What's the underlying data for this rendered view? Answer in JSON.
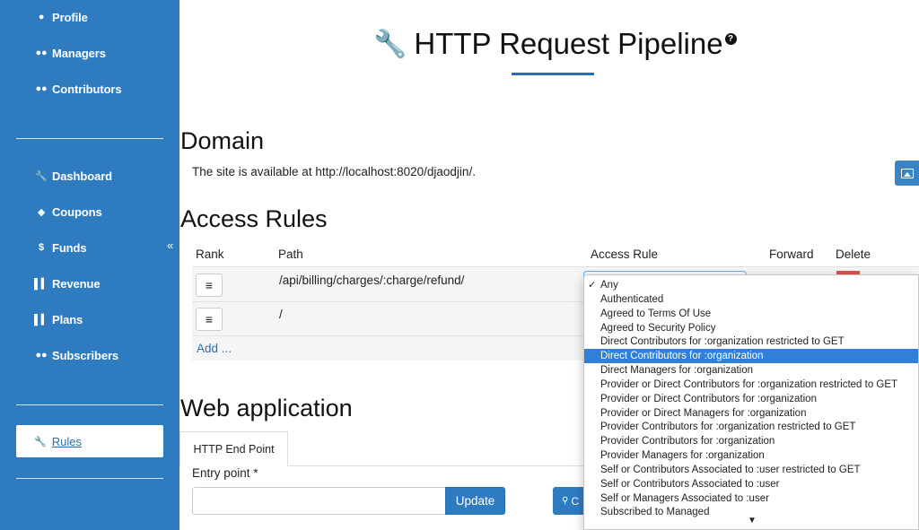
{
  "sidebar": {
    "items_top": [
      {
        "label": "Profile",
        "icon": "user-icon"
      },
      {
        "label": "Managers",
        "icon": "users-icon"
      },
      {
        "label": "Contributors",
        "icon": "users-icon"
      }
    ],
    "items_main": [
      {
        "label": "Dashboard",
        "icon": "wrench-icon"
      },
      {
        "label": "Coupons",
        "icon": "tag-icon"
      },
      {
        "label": "Funds",
        "icon": "dollar-icon"
      },
      {
        "label": "Revenue",
        "icon": "bar-chart-icon"
      },
      {
        "label": "Plans",
        "icon": "bar-chart-icon"
      },
      {
        "label": "Subscribers",
        "icon": "users-icon"
      }
    ],
    "collapse_glyph": "«",
    "active_item": {
      "label": "Rules",
      "icon": "wrench-icon"
    },
    "accent": "#2f7bbf"
  },
  "header": {
    "title": "HTTP Request Pipeline",
    "help_glyph": "?"
  },
  "domain": {
    "heading": "Domain",
    "text": "The site is available at http://localhost:8020/djaodjin/."
  },
  "access_rules": {
    "heading": "Access Rules",
    "columns": [
      "Rank",
      "Path",
      "Access Rule",
      "Forward",
      "Delete"
    ],
    "rows": [
      {
        "rank_glyph": "≡",
        "path": "/api/billing/charges/:charge/refund/"
      },
      {
        "rank_glyph": "≡",
        "path": "/"
      }
    ],
    "add_label": "Add ..."
  },
  "web_app": {
    "heading": "Web application",
    "tab_label": "HTTP End Point",
    "entry_label": "Entry point *",
    "entry_value": "",
    "update_label": "Update",
    "partial_button_label": "C"
  },
  "dropdown": {
    "options": [
      {
        "label": "Any",
        "checked": true
      },
      {
        "label": "Authenticated"
      },
      {
        "label": "Agreed to Terms Of Use"
      },
      {
        "label": "Agreed to Security Policy"
      },
      {
        "label": "Direct Contributors for :organization restricted to GET"
      },
      {
        "label": "Direct Contributors for :organization",
        "highlighted": true
      },
      {
        "label": "Direct Managers for :organization"
      },
      {
        "label": "Provider or Direct Contributors for :organization restricted to GET"
      },
      {
        "label": "Provider or Direct Contributors for :organization"
      },
      {
        "label": "Provider or Direct Managers for :organization"
      },
      {
        "label": "Provider Contributors for :organization restricted to GET"
      },
      {
        "label": "Provider Contributors for :organization"
      },
      {
        "label": "Provider Managers for :organization"
      },
      {
        "label": "Self or Contributors Associated to :user restricted to GET"
      },
      {
        "label": "Self or Contributors Associated to :user"
      },
      {
        "label": "Self or Managers Associated to :user"
      },
      {
        "label": "Subscribed to Managed"
      }
    ],
    "check_glyph": "✓",
    "scroll_glyph": "▼",
    "highlight_color": "#2f80d6"
  }
}
